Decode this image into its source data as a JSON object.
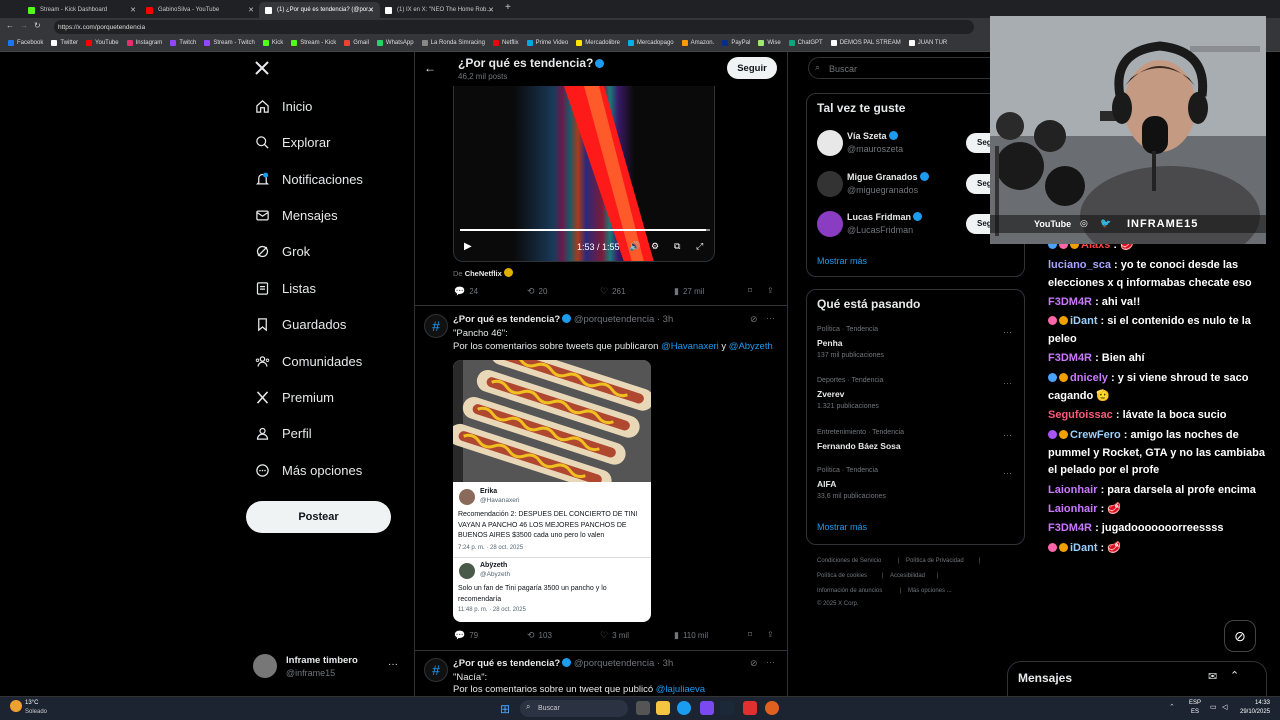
{
  "browser": {
    "tabs": [
      {
        "title": "Stream - Kick Dashboard",
        "color": "#53fc18",
        "active": false
      },
      {
        "title": "GabinoSilva - YouTube",
        "color": "#ff0000",
        "active": false
      },
      {
        "title": "(1) ¿Por qué es tendencia? (@por...",
        "color": "#ffffff",
        "active": true
      },
      {
        "title": "(1) IX en X: \"NEO The Home Rob...",
        "color": "#ffffff",
        "active": false
      }
    ],
    "url": "https://x.com/porquetendencia",
    "bookmarks": [
      {
        "label": "Facebook",
        "color": "#1877f2"
      },
      {
        "label": "Twitter",
        "color": "#ffffff"
      },
      {
        "label": "YouTube",
        "color": "#ff0000"
      },
      {
        "label": "Instagram",
        "color": "#e1306c"
      },
      {
        "label": "Twitch",
        "color": "#9146ff"
      },
      {
        "label": "Stream - Twitch",
        "color": "#9146ff"
      },
      {
        "label": "Kick",
        "color": "#53fc18"
      },
      {
        "label": "Stream - Kick",
        "color": "#53fc18"
      },
      {
        "label": "Gmail",
        "color": "#ea4335"
      },
      {
        "label": "WhatsApp",
        "color": "#25d366"
      },
      {
        "label": "La Ronda Simracing",
        "color": "#888888"
      },
      {
        "label": "Netflix",
        "color": "#e50914"
      },
      {
        "label": "Prime Video",
        "color": "#00a8e1"
      },
      {
        "label": "Mercadolibre",
        "color": "#ffe600"
      },
      {
        "label": "Mercadopago",
        "color": "#00b1ea"
      },
      {
        "label": "Amazon.",
        "color": "#ff9900"
      },
      {
        "label": "PayPal",
        "color": "#003087"
      },
      {
        "label": "Wise",
        "color": "#9fe870"
      },
      {
        "label": "ChatGPT",
        "color": "#10a37f"
      },
      {
        "label": "DEMOS PAL STREAM",
        "color": "#ffffff"
      },
      {
        "label": "JUAN TUR",
        "color": "#ffffff"
      }
    ]
  },
  "nav": {
    "items": [
      {
        "label": "Inicio",
        "icon": "home-icon"
      },
      {
        "label": "Explorar",
        "icon": "search-icon"
      },
      {
        "label": "Notificaciones",
        "icon": "bell-icon"
      },
      {
        "label": "Mensajes",
        "icon": "mail-icon"
      },
      {
        "label": "Grok",
        "icon": "grok-icon"
      },
      {
        "label": "Listas",
        "icon": "list-icon"
      },
      {
        "label": "Guardados",
        "icon": "bookmark-icon"
      },
      {
        "label": "Comunidades",
        "icon": "communities-icon"
      },
      {
        "label": "Premium",
        "icon": "x-logo-icon"
      },
      {
        "label": "Perfil",
        "icon": "person-icon"
      },
      {
        "label": "Más opciones",
        "icon": "more-icon"
      }
    ],
    "post_button": "Postear",
    "account": {
      "name": "Inframe timbero",
      "handle": "@inframe15"
    }
  },
  "header": {
    "title": "¿Por qué es tendencia?",
    "count": "46,2 mil posts",
    "follow": "Seguir"
  },
  "video": {
    "time": "1:53 / 1:55",
    "source_prefix": "De",
    "source": "CheNetflix",
    "stats": {
      "replies": "24",
      "reposts": "20",
      "likes": "261",
      "views": "27 mil"
    }
  },
  "tweet1": {
    "name": "¿Por qué es tendencia?",
    "handle": "@porquetendencia · 3h",
    "title": "\"Pancho 46\":",
    "text_prefix": "Por los comentarios sobre tweets que publicaron",
    "mention1": "@Havanaxeri",
    "and": "y",
    "mention2": "@Abyzeth",
    "card": {
      "author1": "Erika",
      "handle1": "@Havanaxeri",
      "text1": "Recomendación 2: DESPUES DEL CONCIERTO DE TINI VAYAN A PANCHO 46 LOS MEJORES PANCHOS DE BUENOS AIRES $3500 cada uno pero lo valen",
      "time1": "7:24 p. m. · 28 oct. 2025",
      "author2": "Abÿzeth",
      "handle2": "@Abyzeth",
      "text2": "Solo un fan de Tini pagaría 3500 un pancho y lo recomendaría",
      "time2": "11:48 p. m. · 28 oct. 2025"
    },
    "stats": {
      "replies": "79",
      "reposts": "103",
      "likes": "3 mil",
      "views": "110 mil"
    }
  },
  "tweet2": {
    "name": "¿Por qué es tendencia?",
    "handle": "@porquetendencia · 3h",
    "title": "\"Nacía\":",
    "text_prefix": "Por los comentarios sobre un tweet que publicó",
    "mention": "@lajuliaeva"
  },
  "right": {
    "search_placeholder": "Buscar",
    "who_title": "Tal vez te guste",
    "who": [
      {
        "name": "Vía Szeta",
        "handle": "@mauroszeta",
        "btn": "Seguir",
        "color": "#e8e8e8"
      },
      {
        "name": "Migue Granados",
        "handle": "@miguegranados",
        "btn": "Seguir",
        "color": "#333333"
      },
      {
        "name": "Lucas Fridman",
        "handle": "@LucasFridman",
        "btn": "Seguir",
        "color": "#8a3cc2"
      }
    ],
    "show_more": "Mostrar más",
    "trends_title": "Qué está pasando",
    "trends": [
      {
        "cat": "Política · Tendencia",
        "name": "Penha",
        "count": "137 mil publicaciones"
      },
      {
        "cat": "Deportes · Tendencia",
        "name": "Zverev",
        "count": "1.321 publicaciones"
      },
      {
        "cat": "Entretenimiento · Tendencia",
        "name": "Fernando Báez Sosa",
        "count": ""
      },
      {
        "cat": "Política · Tendencia",
        "name": "AIFA",
        "count": "33,6 mil publicaciones"
      }
    ],
    "show_more2": "Mostrar más",
    "footer": [
      "Condiciones de Servicio",
      "Política de Privacidad",
      "Política de cookies",
      "Accesibilidad",
      "Información de anuncios",
      "Más opciones ...",
      "© 2025 X Corp."
    ]
  },
  "stream": {
    "overlay": {
      "yt": "YouTube",
      "name": "INFRAME15"
    },
    "chat": [
      {
        "user": "Alaxs",
        "msg": "🥩",
        "color": "#ff4444",
        "badges": [
          "#4aa3ff",
          "#ff66aa",
          "#f0a000"
        ]
      },
      {
        "user": "luciano_sca",
        "msg": "yo te conoci desde las elecciones x q informabas checate eso",
        "color": "#a8a4ff",
        "badges": []
      },
      {
        "user": "F3DM4R",
        "msg": "ahi va!!",
        "color": "#c879ff",
        "badges": []
      },
      {
        "user": "iDant",
        "msg": "si el contenido es nulo te la peleo",
        "color": "#9ad0ff",
        "badges": [
          "#ff66aa",
          "#f0a000"
        ]
      },
      {
        "user": "F3DM4R",
        "msg": "Bien ahí",
        "color": "#c879ff",
        "badges": []
      },
      {
        "user": "dnicely",
        "msg": "y si viene shroud te saco cagando 🫡",
        "color": "#c879ff",
        "badges": [
          "#4aa3ff",
          "#f0a000"
        ]
      },
      {
        "user": "Segufoissac",
        "msg": "lávate la boca sucio",
        "color": "#ff5a7a",
        "badges": []
      },
      {
        "user": "CrewFero",
        "msg": "amigo las noches de pummel y Rocket, GTA y no las cambiaba el pelado por el profe",
        "color": "#9ad0ff",
        "badges": [
          "#a855f7",
          "#f0a000"
        ]
      },
      {
        "user": "Laionhair",
        "msg": "para darsela al profe encima",
        "color": "#c879ff",
        "badges": []
      },
      {
        "user": "Laionhair",
        "msg": "🥩",
        "color": "#c879ff",
        "badges": []
      },
      {
        "user": "F3DM4R",
        "msg": "jugadooooooorreessss",
        "color": "#c879ff",
        "badges": []
      },
      {
        "user": "iDant",
        "msg": "🥩",
        "color": "#9ad0ff",
        "badges": [
          "#ff66aa",
          "#f0a000"
        ]
      }
    ],
    "dock": "Mensajes"
  },
  "taskbar": {
    "weather_temp": "13°C",
    "weather_desc": "Soleado",
    "search": "Buscar",
    "lang1": "ESP",
    "lang2": "ES",
    "time": "14:33",
    "date": "29/10/2025"
  }
}
